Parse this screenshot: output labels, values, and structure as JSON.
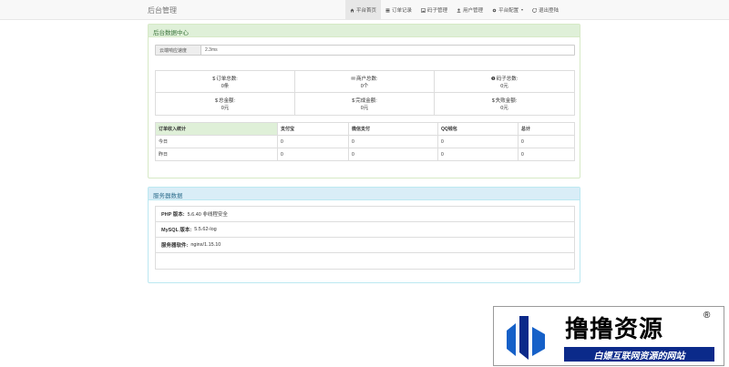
{
  "navbar": {
    "brand": "后台管理",
    "items": [
      {
        "label": "平台首页",
        "icon": "home-icon",
        "active": true
      },
      {
        "label": "订单记录",
        "icon": "list-icon",
        "active": false
      },
      {
        "label": "码子管理",
        "icon": "image-icon",
        "active": false
      },
      {
        "label": "用户管理",
        "icon": "user-icon",
        "active": false
      },
      {
        "label": "平台配置",
        "icon": "gear-icon",
        "active": false
      },
      {
        "label": "退出登陆",
        "icon": "logout-icon",
        "active": false
      }
    ]
  },
  "dashboard": {
    "title": "后台数据中心",
    "speed_label": "云端响应速度",
    "speed_value": "2.3ms",
    "stats": [
      {
        "label": "订单总数:",
        "value": "0条",
        "glyph": "$",
        "icon": "yen-icon"
      },
      {
        "label": "商户总数:",
        "value": "0个",
        "glyph": "✉",
        "icon": "merchant-icon"
      },
      {
        "label": "码子总数:",
        "value": "0元",
        "glyph": "❶",
        "icon": "code-icon"
      },
      {
        "label": "总金额:",
        "value": "0元",
        "glyph": "$",
        "icon": "dollar-icon"
      },
      {
        "label": "完成金额:",
        "value": "0元",
        "glyph": "$",
        "icon": "dollar-icon"
      },
      {
        "label": "失败金额:",
        "value": "0元",
        "glyph": "$",
        "icon": "dollar-icon"
      }
    ],
    "income_table": {
      "headers": [
        "订单收入统计",
        "支付宝",
        "微信支付",
        "QQ钱包",
        "总计"
      ],
      "rows": [
        [
          "今日",
          "0",
          "0",
          "0",
          "0"
        ],
        [
          "昨日",
          "0",
          "0",
          "0",
          "0"
        ]
      ]
    }
  },
  "server": {
    "title": "服务器数据",
    "rows": [
      {
        "label": "PHP 版本:",
        "value": "5.6.40 非线程安全"
      },
      {
        "label": "MySQL 版本:",
        "value": "5.5.62-log"
      },
      {
        "label": "服务器软件:",
        "value": "nginx/1.15.10"
      },
      {
        "label": "",
        "value": ""
      }
    ]
  },
  "watermark": {
    "title": "撸撸资源",
    "reg": "®",
    "subtitle": "白嫖互联网资源的网站",
    "colors": {
      "blue": "#0b2a8a",
      "accent": "#1560c8"
    }
  },
  "colors": {
    "success_bg": "#dff0d8",
    "success_text": "#3c763d",
    "info_bg": "#d9edf7",
    "info_text": "#31708f"
  }
}
